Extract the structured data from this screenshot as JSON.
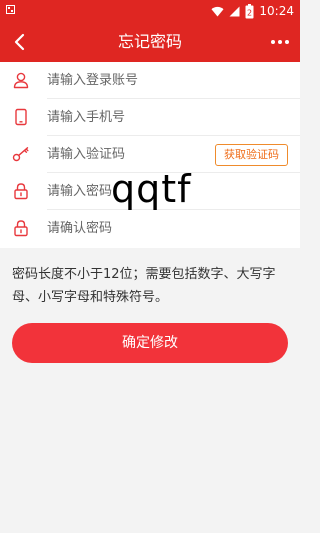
{
  "status_bar": {
    "time": "10:24",
    "battery_level": "2"
  },
  "app_bar": {
    "title": "忘记密码",
    "back_icon": "chevron-left-icon",
    "more_icon": "more-dots-icon"
  },
  "form": {
    "account": {
      "placeholder": "请输入登录账号",
      "icon": "user-icon"
    },
    "phone": {
      "placeholder": "请输入手机号",
      "icon": "phone-icon"
    },
    "code": {
      "placeholder": "请输入验证码",
      "icon": "key-icon",
      "button": "获取验证码"
    },
    "password": {
      "placeholder": "请输入密码",
      "icon": "lock-icon"
    },
    "confirm": {
      "placeholder": "请确认密码",
      "icon": "lock-icon"
    }
  },
  "watermark": "qqtf",
  "hint": "密码长度不小于12位；需要包括数字、大写字母、小写字母和特殊符号。",
  "submit_label": "确定修改",
  "colors": {
    "header": "#df2622",
    "button": "#f2333a",
    "code_button": "#ef6d19"
  }
}
